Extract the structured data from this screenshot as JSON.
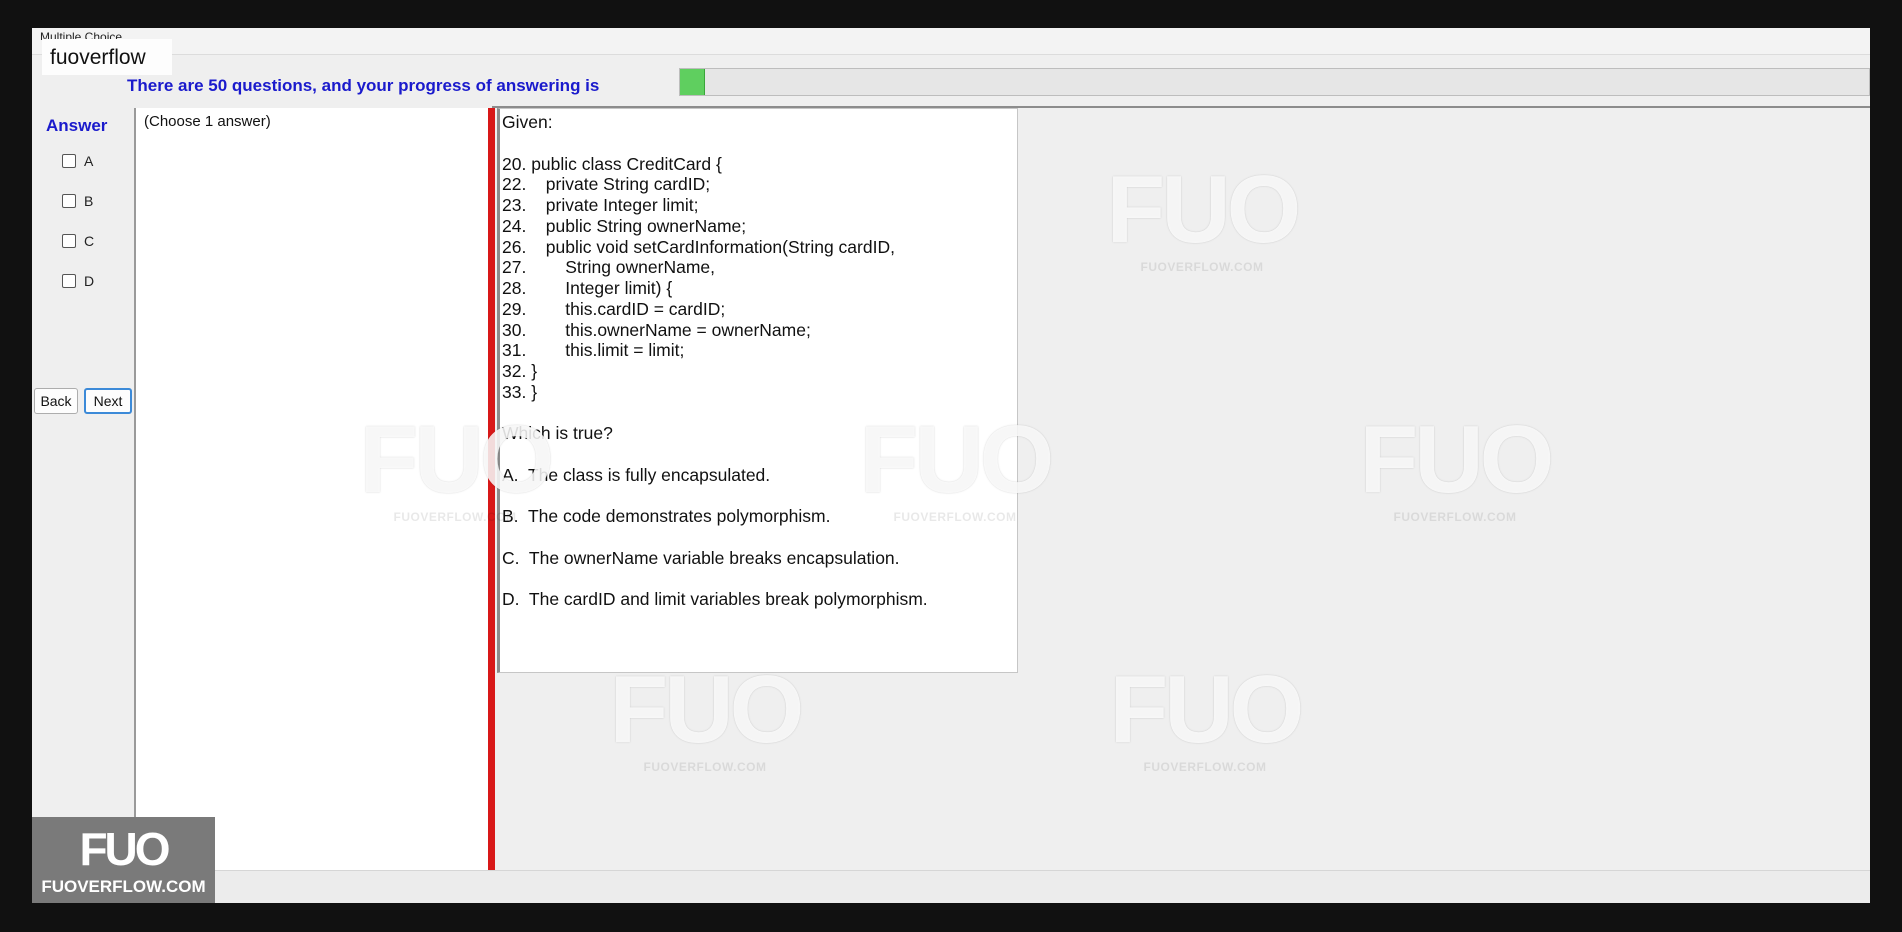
{
  "window": {
    "title": "Multiple Choice"
  },
  "brand": {
    "name": "fuoverflow"
  },
  "progress": {
    "label": "There are 50 questions, and your progress of answering is",
    "total_questions": 50,
    "fraction": 0.02,
    "fill_color": "#5fcf5f"
  },
  "answer_panel": {
    "heading": "Answer",
    "options": [
      {
        "label": "A",
        "checked": false
      },
      {
        "label": "B",
        "checked": false
      },
      {
        "label": "C",
        "checked": false
      },
      {
        "label": "D",
        "checked": false
      }
    ]
  },
  "nav": {
    "back_label": "Back",
    "next_label": "Next"
  },
  "choose_hint": "(Choose 1 answer)",
  "question": {
    "text": "Given:\n\n20. public class CreditCard {\n22.    private String cardID;\n23.    private Integer limit;\n24.    public String ownerName;\n26.    public void setCardInformation(String cardID,\n27.        String ownerName,\n28.        Integer limit) {\n29.        this.cardID = cardID;\n30.        this.ownerName = ownerName;\n31.        this.limit = limit;\n32. }\n33. }\n\nWhich is true?\n\nA.  The class is fully encapsulated.\n\nB.  The code demonstrates polymorphism.\n\nC.  The ownerName variable breaks encapsulation.\n\nD.  The cardID and limit variables break polymorphism."
  },
  "watermark": {
    "logo": "FUO",
    "site": "FUOVERFLOW.COM"
  },
  "colors": {
    "accent_blue": "#1a1acc",
    "splitter_red": "#d81818"
  }
}
